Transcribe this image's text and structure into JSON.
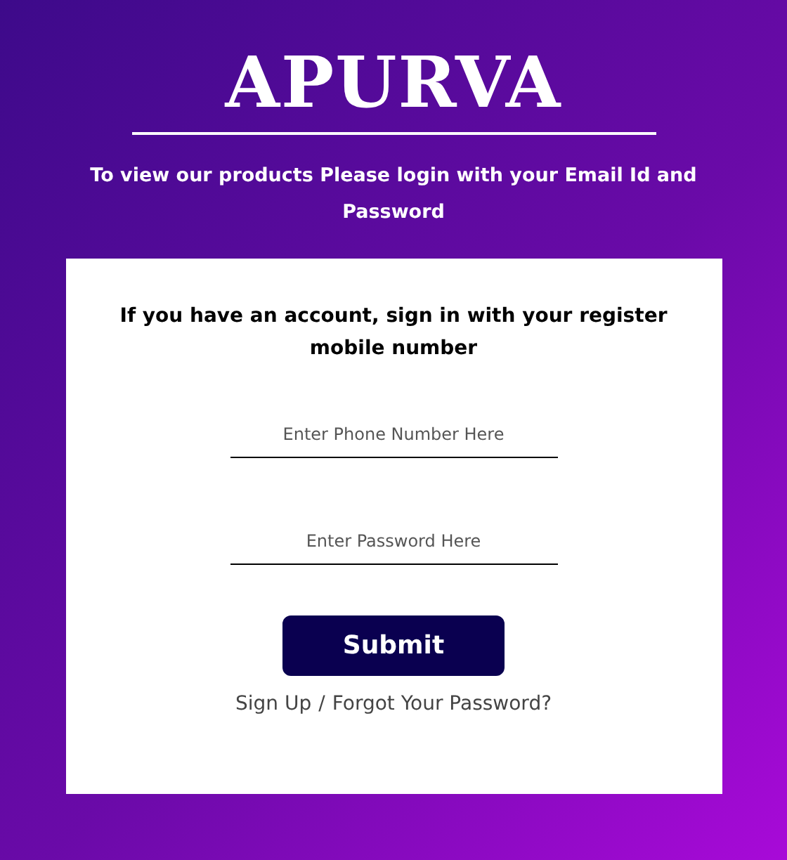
{
  "brand": "APURVA",
  "intro": "To view our products Please login with your Email Id and Password",
  "card": {
    "heading": "If you have an account, sign in with your register mobile number",
    "fields": [
      {
        "placeholder": "Enter Phone Number Here"
      },
      {
        "placeholder": "Enter Password Here"
      }
    ],
    "submit": "Submit",
    "links": [
      "Sign Up",
      "Forgot Your Password?"
    ],
    "separator": "/"
  }
}
